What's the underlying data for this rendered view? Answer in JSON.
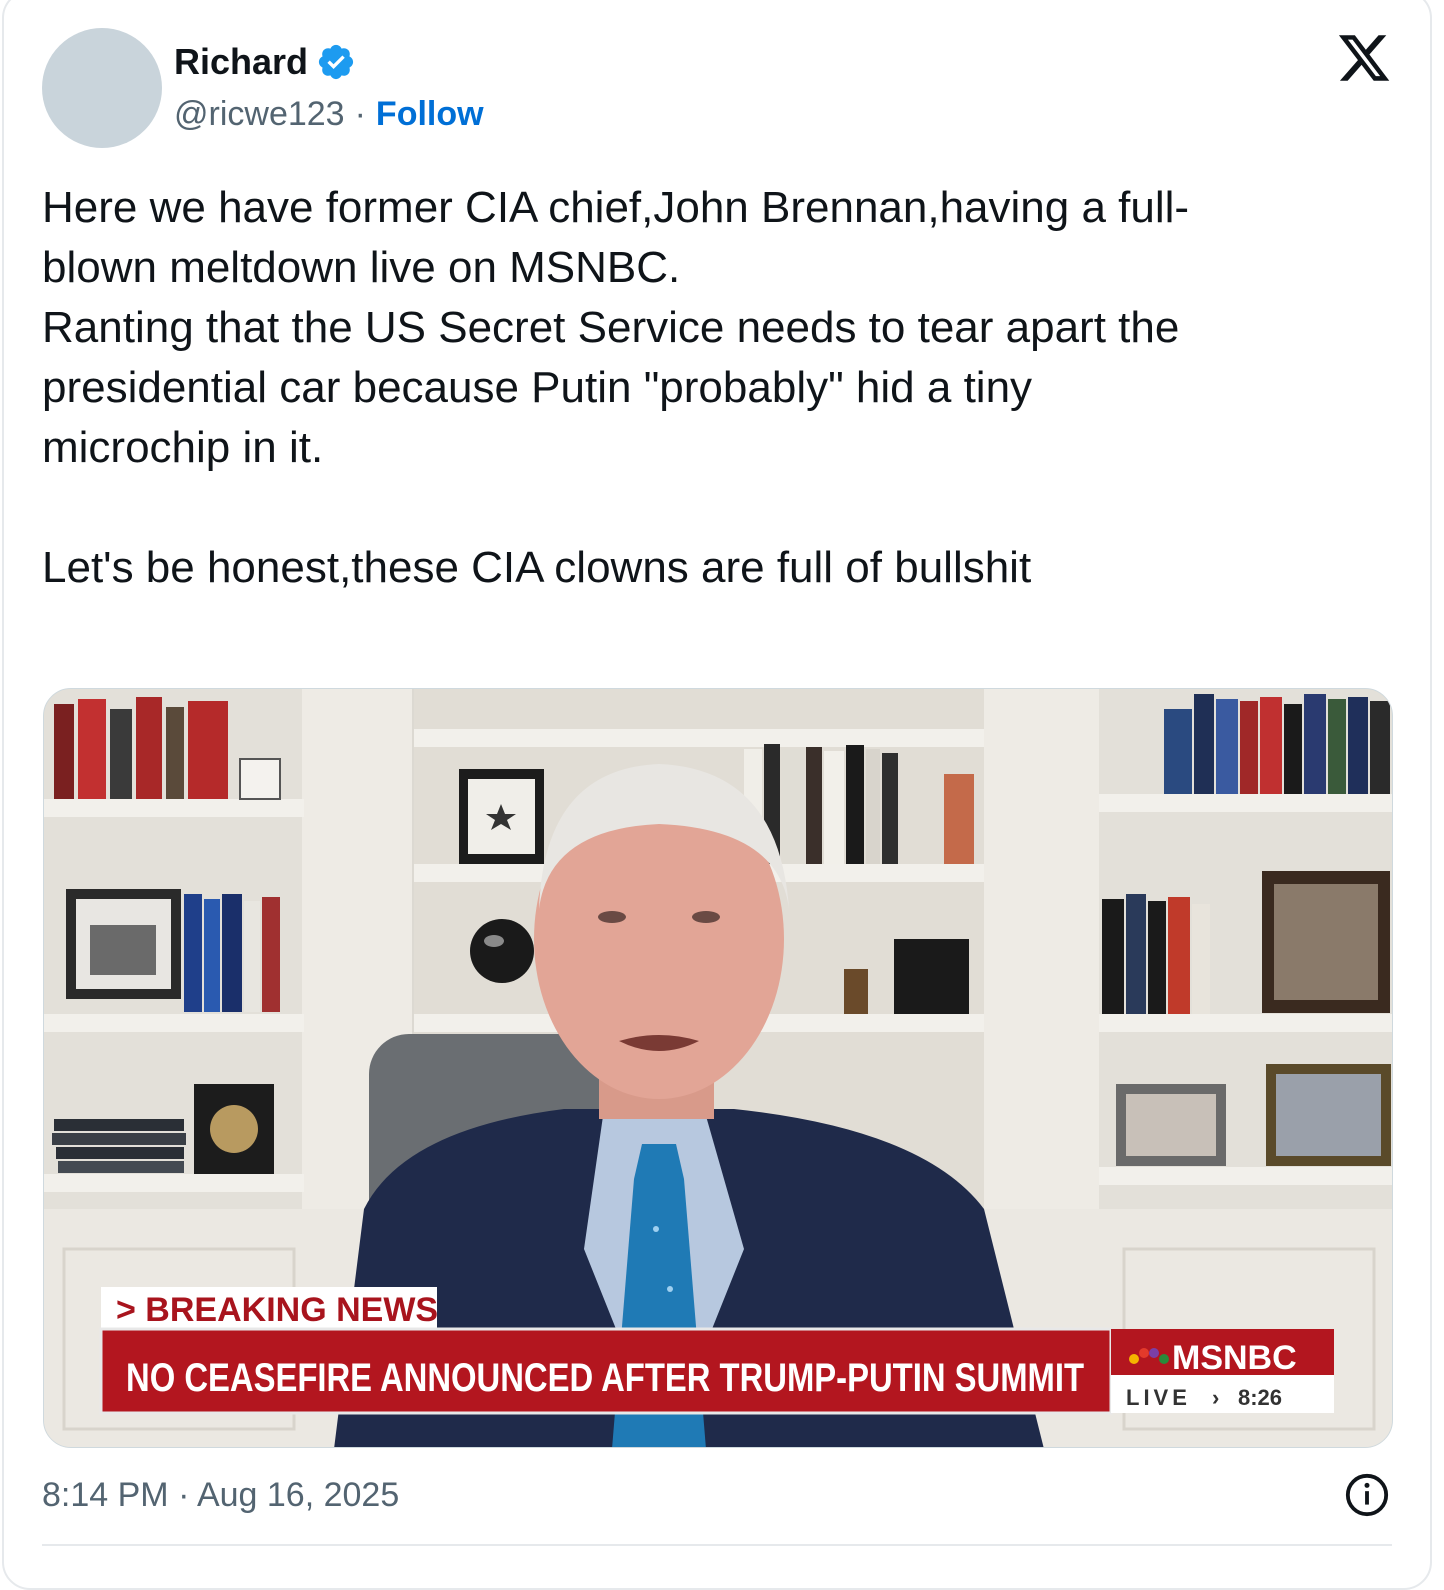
{
  "author": {
    "display_name": "Richard",
    "handle": "@ricwe123",
    "separator": "·",
    "follow_label": "Follow"
  },
  "tweet": {
    "text": "Here we have former CIA chief,John Brennan,having a full-\nblown meltdown live on MSNBC.\nRanting that the US Secret Service needs to tear apart the\npresidential car because Putin \"probably\" hid a tiny\nmicrochip in it.\n\nLet's be honest,these CIA clowns are full of bullshit",
    "timestamp": "8:14 PM · Aug 16, 2025"
  },
  "media": {
    "breaking_label": "> BREAKING NEWS",
    "headline": "NO CEASEFIRE ANNOUNCED AFTER TRUMP-PUTIN SUMMIT",
    "network": "MSNBC",
    "live_label": "LIVE",
    "live_arrow": "›",
    "time": "8:26"
  },
  "colors": {
    "verified": "#1d9bf0",
    "follow": "#006fd6",
    "chyron_red": "#b3161f",
    "secondary_text": "#536471"
  },
  "icons": {
    "verified": "verified-badge-icon",
    "x_logo": "x-logo-icon",
    "info": "info-icon"
  }
}
